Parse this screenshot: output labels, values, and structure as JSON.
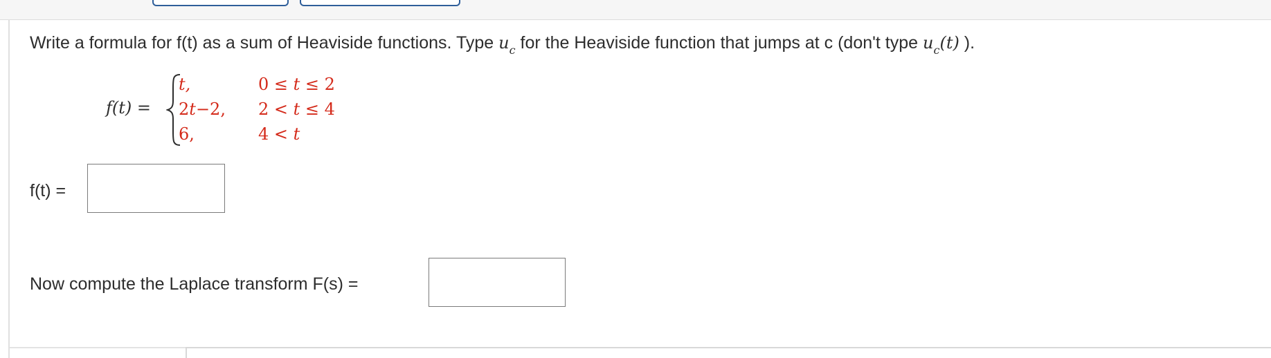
{
  "instructions": {
    "part1": "Write a formula for f(t) as a sum of Heaviside functions. Type",
    "uc_symbol": "u",
    "uc_subscript": "c",
    "part2": "for the Heaviside function that jumps at c (don't type",
    "part3_symbol": "u",
    "part3_subscript": "c",
    "part3_arg": "(t)",
    "part4": ")."
  },
  "piecewise": {
    "lhs": "f(t) =",
    "rows": [
      {
        "expr": "t,",
        "cond": "0 ≤ t ≤ 2"
      },
      {
        "expr": "2t−2,",
        "cond": "2 < t ≤ 4"
      },
      {
        "expr": "6,",
        "cond": "4 < t"
      }
    ]
  },
  "answer_ft": {
    "label": "f(t) =",
    "value": ""
  },
  "laplace": {
    "label": "Now compute the Laplace transform F(s) =",
    "value": ""
  },
  "colors": {
    "variable_red": "#d42a1a",
    "button_border": "#2e5e9a"
  }
}
